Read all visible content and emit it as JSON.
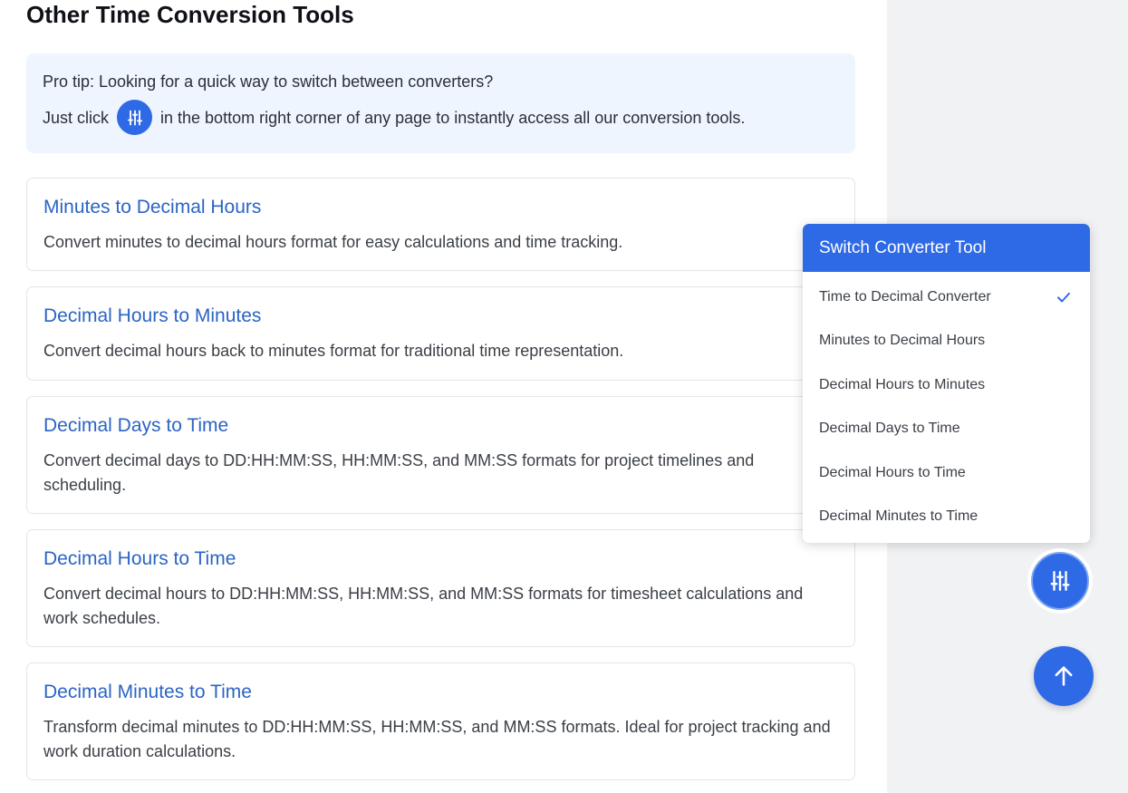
{
  "page": {
    "title": "Other Time Conversion Tools"
  },
  "tip": {
    "line1": "Pro tip: Looking for a quick way to switch between converters?",
    "line2_before": "Just click",
    "line2_after": "in the bottom right corner of any page to instantly access all our conversion tools.",
    "icon": "sliders-icon"
  },
  "tools": [
    {
      "title": "Minutes to Decimal Hours",
      "description": "Convert minutes to decimal hours format for easy calculations and time tracking."
    },
    {
      "title": "Decimal Hours to Minutes",
      "description": "Convert decimal hours back to minutes format for traditional time representation."
    },
    {
      "title": "Decimal Days to Time",
      "description": "Convert decimal days to DD:HH:MM:SS, HH:MM:SS, and MM:SS formats for project timelines and scheduling."
    },
    {
      "title": "Decimal Hours to Time",
      "description": "Convert decimal hours to DD:HH:MM:SS, HH:MM:SS, and MM:SS formats for timesheet calculations and work schedules."
    },
    {
      "title": "Decimal Minutes to Time",
      "description": "Transform decimal minutes to DD:HH:MM:SS, HH:MM:SS, and MM:SS formats. Ideal for project tracking and work duration calculations."
    }
  ],
  "switcher": {
    "header": "Switch Converter Tool",
    "items": [
      {
        "label": "Time to Decimal Converter",
        "selected": true
      },
      {
        "label": "Minutes to Decimal Hours",
        "selected": false
      },
      {
        "label": "Decimal Hours to Minutes",
        "selected": false
      },
      {
        "label": "Decimal Days to Time",
        "selected": false
      },
      {
        "label": "Decimal Hours to Time",
        "selected": false
      },
      {
        "label": "Decimal Minutes to Time",
        "selected": false
      }
    ],
    "check_icon": "check-icon",
    "toggle_icon": "sliders-icon"
  },
  "scroll_top": {
    "icon": "arrow-up-icon"
  },
  "colors": {
    "accent": "#2f6ae6",
    "link": "#2b64c4",
    "tip_bg": "#eef5fe",
    "side_bg": "#f1f2f4"
  }
}
